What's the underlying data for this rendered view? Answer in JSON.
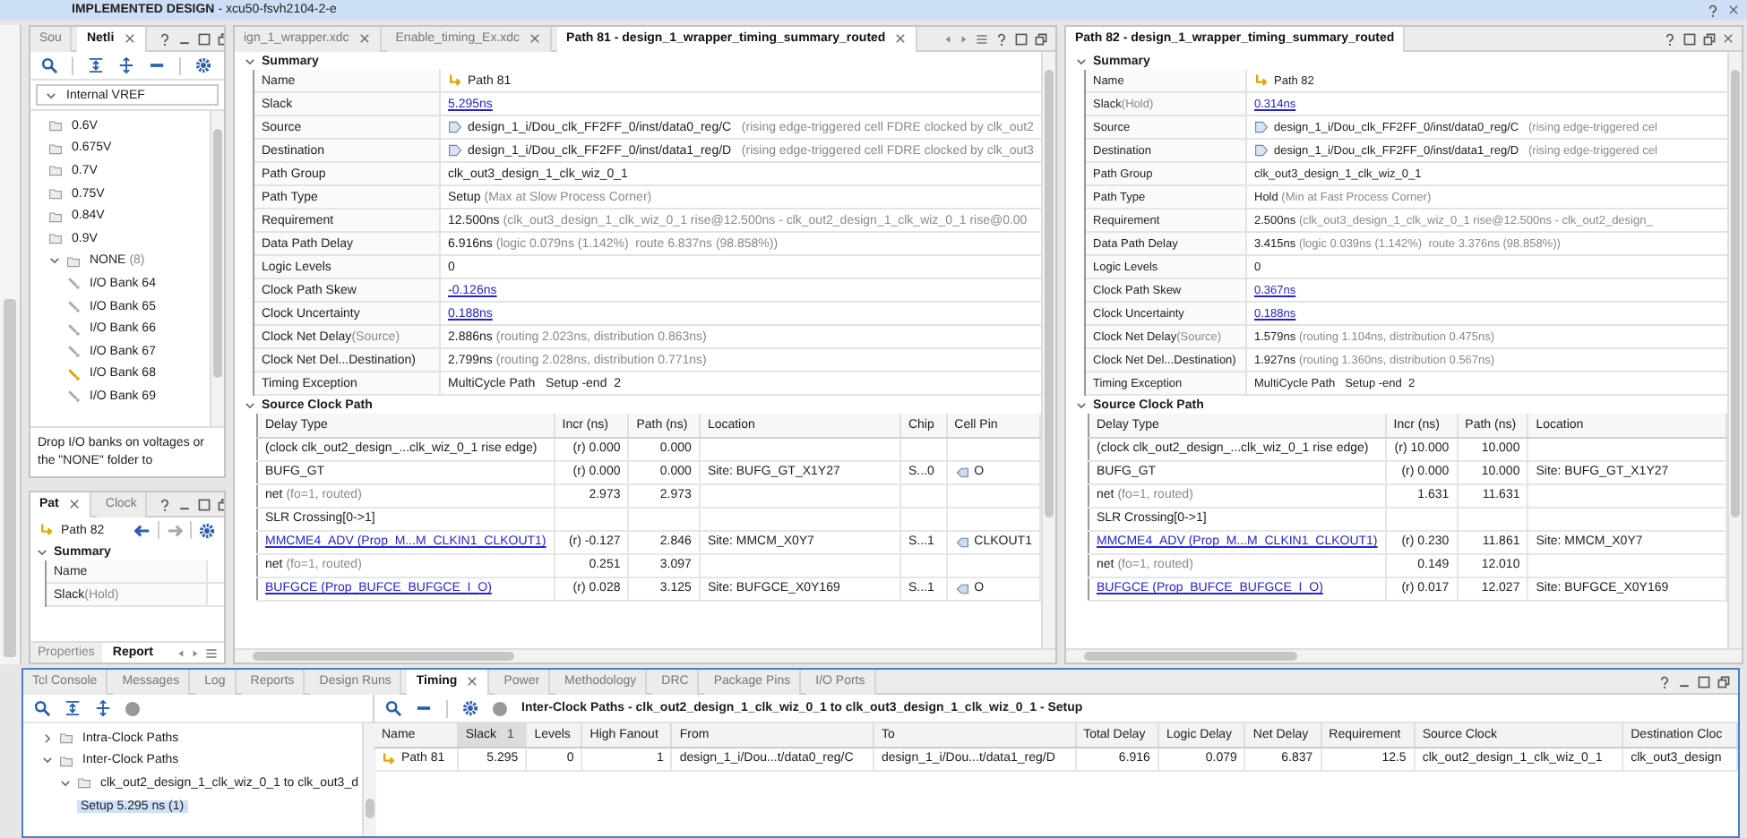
{
  "title_bar": {
    "title": "IMPLEMENTED DESIGN",
    "subtitle": "- xcu50-fsvh2104-2-e"
  },
  "io_panel": {
    "tabs": [
      {
        "label": "Sou",
        "selected": false
      },
      {
        "label": "Netli",
        "selected": true
      }
    ],
    "filter": "Internal VREF",
    "tree": [
      {
        "label": "0.6V"
      },
      {
        "label": "0.675V"
      },
      {
        "label": "0.7V"
      },
      {
        "label": "0.75V"
      },
      {
        "label": "0.84V"
      },
      {
        "label": "0.9V"
      },
      {
        "label": "NONE",
        "count": "(8)",
        "expanded": true,
        "children": [
          {
            "label": "I/O Bank 64",
            "highlighted": false
          },
          {
            "label": "I/O Bank 65",
            "highlighted": false
          },
          {
            "label": "I/O Bank 66",
            "highlighted": false
          },
          {
            "label": "I/O Bank 67",
            "highlighted": false
          },
          {
            "label": "I/O Bank 68",
            "highlighted": true
          },
          {
            "label": "I/O Bank 69",
            "highlighted": false
          }
        ]
      }
    ],
    "hint": "Drop I/O banks on voltages or the \"NONE\" folder to"
  },
  "path_panel": {
    "tabs": [
      {
        "label": "Pat",
        "selected": true
      },
      {
        "label": "Clock",
        "selected": false
      }
    ],
    "path": "Path 82",
    "section": "Summary",
    "rows": [
      {
        "label": "Name"
      },
      {
        "label": "Slack",
        "note": "(Hold)"
      }
    ],
    "footer_tabs": [
      {
        "label": "Properties",
        "selected": false
      },
      {
        "label": "Report",
        "selected": true
      }
    ]
  },
  "center": {
    "tabs": [
      {
        "label": "ign_1_wrapper.xdc",
        "selected": false
      },
      {
        "label": "Enable_timing_Ex.xdc",
        "selected": false
      },
      {
        "label": "Path 81 - design_1_wrapper_timing_summary_routed",
        "selected": true
      }
    ],
    "summary": {
      "title": "Summary",
      "rows": [
        {
          "label": "Name",
          "value": "Path 81",
          "kind": "path"
        },
        {
          "label": "Slack",
          "value": "5.295ns",
          "kind": "link"
        },
        {
          "label": "Source",
          "value": "design_1_i/Dou_clk_FF2FF_0/inst/data0_reg/C",
          "detail": "(rising edge-triggered cell FDRE clocked by clk_out2",
          "kind": "cell"
        },
        {
          "label": "Destination",
          "value": "design_1_i/Dou_clk_FF2FF_0/inst/data1_reg/D",
          "detail": "(rising edge-triggered cell FDRE clocked by clk_out3",
          "kind": "cell"
        },
        {
          "label": "Path Group",
          "value": "clk_out3_design_1_clk_wiz_0_1",
          "kind": "text"
        },
        {
          "label": "Path Type",
          "value": "Setup",
          "detail": "(Max at Slow Process Corner)",
          "kind": "text"
        },
        {
          "label": "Requirement",
          "value": "12.500ns",
          "detail": "(clk_out3_design_1_clk_wiz_0_1 rise@12.500ns - clk_out2_design_1_clk_wiz_0_1 rise@0.00",
          "kind": "text"
        },
        {
          "label": "Data Path Delay",
          "value": "6.916ns",
          "detail": "(logic 0.079ns (1.142%)  route 6.837ns (98.858%))",
          "kind": "text"
        },
        {
          "label": "Logic Levels",
          "value": "0",
          "kind": "text"
        },
        {
          "label": "Clock Path Skew",
          "value": "-0.126ns",
          "kind": "link"
        },
        {
          "label": "Clock Uncertainty",
          "value": "0.188ns",
          "kind": "link"
        },
        {
          "label": "Clock Net Delay",
          "note": "(Source)",
          "value": "2.886ns",
          "detail": "(routing 2.023ns, distribution 0.863ns)",
          "kind": "text"
        },
        {
          "label": "Clock Net Del...Destination)",
          "value": "2.799ns",
          "detail": "(routing 2.028ns, distribution 0.771ns)",
          "kind": "text"
        },
        {
          "label": "Timing Exception",
          "value": "MultiCycle Path   Setup -end  2",
          "kind": "text"
        }
      ]
    },
    "clock_path": {
      "title": "Source Clock Path",
      "columns": [
        "Delay Type",
        "Incr (ns)",
        "Path (ns)",
        "Location",
        "Chip",
        "Cell Pin"
      ],
      "rows": [
        {
          "delay": {
            "label": "(clock clk_out2_design_...clk_wiz_0_1 rise edge)",
            "kind": "text"
          },
          "incr": "(r) 0.000",
          "path": "0.000"
        },
        {
          "delay": {
            "label": "BUFG_GT",
            "kind": "text"
          },
          "incr": "(r) 0.000",
          "path": "0.000",
          "location": "Site: BUFG_GT_X1Y27",
          "chip": "S...0",
          "pin": "O"
        },
        {
          "delay": {
            "label": "net",
            "note": "(fo=1, routed)",
            "kind": "text"
          },
          "incr": "2.973",
          "path": "2.973"
        },
        {
          "delay": {
            "label": "SLR Crossing[0->1]",
            "kind": "text"
          }
        },
        {
          "delay": {
            "label": "MMCME4_ADV (Prop_M...M_CLKIN1_CLKOUT1)",
            "kind": "link"
          },
          "incr": "(r) -0.127",
          "path": "2.846",
          "location": "Site: MMCM_X0Y7",
          "chip": "S...1",
          "pin": "CLKOUT1"
        },
        {
          "delay": {
            "label": "net",
            "note": "(fo=1, routed)",
            "kind": "text"
          },
          "incr": "0.251",
          "path": "3.097"
        },
        {
          "delay": {
            "label": "BUFGCE (Prop_BUFCE_BUFGCE_I_O)",
            "kind": "link"
          },
          "incr": "(r) 0.028",
          "path": "3.125",
          "location": "Site: BUFGCE_X0Y169",
          "chip": "S...1",
          "pin": "O"
        }
      ]
    }
  },
  "right": {
    "title": "Path 82 - design_1_wrapper_timing_summary_routed",
    "summary": {
      "title": "Summary",
      "rows": [
        {
          "label": "Name",
          "value": "Path 82",
          "kind": "path"
        },
        {
          "label": "Slack",
          "note": "(Hold)",
          "value": "0.314ns",
          "kind": "link"
        },
        {
          "label": "Source",
          "value": "design_1_i/Dou_clk_FF2FF_0/inst/data0_reg/C",
          "detail": "(rising edge-triggered cel",
          "kind": "cell"
        },
        {
          "label": "Destination",
          "value": "design_1_i/Dou_clk_FF2FF_0/inst/data1_reg/D",
          "detail": "(rising edge-triggered cel",
          "kind": "cell"
        },
        {
          "label": "Path Group",
          "value": "clk_out3_design_1_clk_wiz_0_1",
          "kind": "text"
        },
        {
          "label": "Path Type",
          "value": "Hold",
          "detail": "(Min at Fast Process Corner)",
          "kind": "text"
        },
        {
          "label": "Requirement",
          "value": "2.500ns",
          "detail": "(clk_out3_design_1_clk_wiz_0_1 rise@12.500ns - clk_out2_design_",
          "kind": "text"
        },
        {
          "label": "Data Path Delay",
          "value": "3.415ns",
          "detail": "(logic 0.039ns (1.142%)  route 3.376ns (98.858%))",
          "kind": "text"
        },
        {
          "label": "Logic Levels",
          "value": "0",
          "kind": "text"
        },
        {
          "label": "Clock Path Skew",
          "value": "0.367ns",
          "kind": "link"
        },
        {
          "label": "Clock Uncertainty",
          "value": "0.188ns",
          "kind": "link"
        },
        {
          "label": "Clock Net Delay",
          "note": "(Source)",
          "value": "1.579ns",
          "detail": "(routing 1.104ns, distribution 0.475ns)",
          "kind": "text"
        },
        {
          "label": "Clock Net Del...Destination)",
          "value": "1.927ns",
          "detail": "(routing 1.360ns, distribution 0.567ns)",
          "kind": "text"
        },
        {
          "label": "Timing Exception",
          "value": "MultiCycle Path   Setup -end  2",
          "kind": "text"
        }
      ]
    },
    "clock_path": {
      "title": "Source Clock Path",
      "columns": [
        "Delay Type",
        "Incr (ns)",
        "Path (ns)",
        "Location"
      ],
      "rows": [
        {
          "delay": {
            "label": "(clock clk_out2_design_...clk_wiz_0_1 rise edge)",
            "kind": "text"
          },
          "incr": "(r) 10.000",
          "path": "10.000"
        },
        {
          "delay": {
            "label": "BUFG_GT",
            "kind": "text"
          },
          "incr": "(r) 0.000",
          "path": "10.000",
          "location": "Site: BUFG_GT_X1Y27"
        },
        {
          "delay": {
            "label": "net",
            "note": "(fo=1, routed)",
            "kind": "text"
          },
          "incr": "1.631",
          "path": "11.631"
        },
        {
          "delay": {
            "label": "SLR Crossing[0->1]",
            "kind": "text"
          }
        },
        {
          "delay": {
            "label": "MMCME4_ADV (Prop_M...M_CLKIN1_CLKOUT1)",
            "kind": "link"
          },
          "incr": "(r) 0.230",
          "path": "11.861",
          "location": "Site: MMCM_X0Y7"
        },
        {
          "delay": {
            "label": "net",
            "note": "(fo=1, routed)",
            "kind": "text"
          },
          "incr": "0.149",
          "path": "12.010"
        },
        {
          "delay": {
            "label": "BUFGCE (Prop_BUFCE_BUFGCE_I_O)",
            "kind": "link"
          },
          "incr": "(r) 0.017",
          "path": "12.027",
          "location": "Site: BUFGCE_X0Y169"
        }
      ]
    }
  },
  "bottom": {
    "tabs": [
      {
        "label": "Tcl Console",
        "selected": false
      },
      {
        "label": "Messages",
        "selected": false
      },
      {
        "label": "Log",
        "selected": false
      },
      {
        "label": "Reports",
        "selected": false
      },
      {
        "label": "Design Runs",
        "selected": false
      },
      {
        "label": "Timing",
        "selected": true
      },
      {
        "label": "Power",
        "selected": false
      },
      {
        "label": "Methodology",
        "selected": false
      },
      {
        "label": "DRC",
        "selected": false
      },
      {
        "label": "Package Pins",
        "selected": false
      },
      {
        "label": "I/O Ports",
        "selected": false
      }
    ],
    "tree": [
      {
        "label": "Intra-Clock Paths",
        "expanded": false,
        "selected": false
      },
      {
        "label": "Inter-Clock Paths",
        "expanded": true,
        "selected": false,
        "children": [
          {
            "label": "clk_out2_design_1_clk_wiz_0_1 to clk_out3_d",
            "expanded": true,
            "selected": false,
            "children": [
              {
                "label": "Setup 5.295 ns (1)",
                "selected": true
              }
            ]
          }
        ]
      }
    ],
    "table_title": "Inter-Clock Paths - clk_out2_design_1_clk_wiz_0_1 to clk_out3_design_1_clk_wiz_0_1 - Setup",
    "columns": [
      {
        "label": "Name"
      },
      {
        "label": "Slack",
        "sort": "1"
      },
      {
        "label": "Levels"
      },
      {
        "label": "High Fanout"
      },
      {
        "label": "From"
      },
      {
        "label": "To"
      },
      {
        "label": "Total Delay"
      },
      {
        "label": "Logic Delay"
      },
      {
        "label": "Net Delay"
      },
      {
        "label": "Requirement"
      },
      {
        "label": "Source Clock"
      },
      {
        "label": "Destination Cloc"
      }
    ],
    "rows": [
      {
        "cells": [
          "Path 81",
          "5.295",
          "0",
          "1",
          "design_1_i/Dou...t/data0_reg/C",
          "design_1_i/Dou...t/data1_reg/D",
          "6.916",
          "0.079",
          "6.837",
          "12.5",
          "clk_out2_design_1_clk_wiz_0_1",
          "clk_out3_design"
        ]
      }
    ]
  }
}
